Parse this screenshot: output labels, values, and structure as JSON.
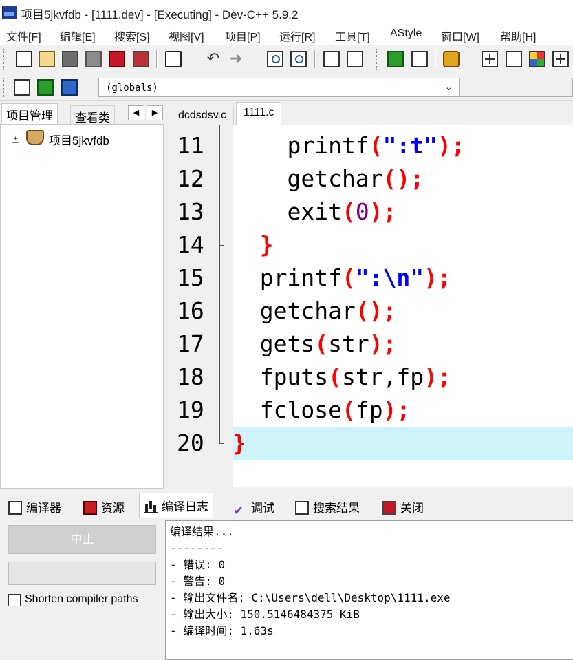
{
  "window": {
    "title": "项目5jkvfdb - [1111.dev] - [Executing] - Dev-C++ 5.9.2",
    "app_icon_label": "DEV"
  },
  "menu": [
    "文件[F]",
    "编辑[E]",
    "搜索[S]",
    "视图[V]",
    "项目[P]",
    "运行[R]",
    "工具[T]",
    "AStyle",
    "窗口[W]",
    "帮助[H]"
  ],
  "toolbar": {
    "icons": [
      "new-file-icon",
      "open-project-icon",
      "save-icon",
      "save-all-icon",
      "close-icon",
      "close-all-icon",
      "print-icon",
      "undo-icon",
      "redo-icon",
      "find-icon",
      "find-replace-icon",
      "indent-icon",
      "unindent-icon",
      "add-to-project-icon",
      "remove-from-project-icon",
      "goto-line-icon",
      "grid-icon",
      "window-icon",
      "color-icon",
      "tiles-icon"
    ],
    "scope_combo_value": "(globals)"
  },
  "left_panel": {
    "tabs": [
      "项目管理",
      "查看类"
    ],
    "active_tab": 0,
    "tree": {
      "expander": "+",
      "project_label": "项目5jkvfdb"
    }
  },
  "editor": {
    "tabs": [
      "dcdsdsv.c",
      "1111.c"
    ],
    "active_tab": 1,
    "highlight_line": 20,
    "lines": [
      {
        "num": "11",
        "tokens": [
          [
            "k",
            "    printf"
          ],
          [
            "p",
            "("
          ],
          [
            "s",
            "\":t\""
          ],
          [
            "p",
            ");"
          ]
        ]
      },
      {
        "num": "12",
        "tokens": [
          [
            "k",
            "    getchar"
          ],
          [
            "p",
            "();"
          ]
        ]
      },
      {
        "num": "13",
        "tokens": [
          [
            "k",
            "    exit"
          ],
          [
            "p",
            "("
          ],
          [
            "n",
            "0"
          ],
          [
            "p",
            ");"
          ]
        ]
      },
      {
        "num": "14",
        "tokens": [
          [
            "p",
            "  }"
          ]
        ]
      },
      {
        "num": "15",
        "tokens": [
          [
            "k",
            "  printf"
          ],
          [
            "p",
            "("
          ],
          [
            "s",
            "\":\\n\""
          ],
          [
            "p",
            ");"
          ]
        ]
      },
      {
        "num": "16",
        "tokens": [
          [
            "k",
            "  getchar"
          ],
          [
            "p",
            "();"
          ]
        ]
      },
      {
        "num": "17",
        "tokens": [
          [
            "k",
            "  gets"
          ],
          [
            "p",
            "("
          ],
          [
            "k",
            "str"
          ],
          [
            "p",
            ");"
          ]
        ]
      },
      {
        "num": "18",
        "tokens": [
          [
            "k",
            "  fputs"
          ],
          [
            "p",
            "("
          ],
          [
            "k",
            "str,fp"
          ],
          [
            "p",
            ");"
          ]
        ]
      },
      {
        "num": "19",
        "tokens": [
          [
            "k",
            "  fclose"
          ],
          [
            "p",
            "("
          ],
          [
            "k",
            "fp"
          ],
          [
            "p",
            ");"
          ]
        ]
      },
      {
        "num": "20",
        "tokens": [
          [
            "p",
            "}"
          ]
        ]
      }
    ],
    "colors": {
      "keyword": "#000000",
      "punct": "#ff0000",
      "string": "#0000ff",
      "number": "#800080",
      "highlight": "#cdf5f9"
    }
  },
  "bottom_panel": {
    "tabs": [
      {
        "label": "编译器",
        "icon": "grid-icon"
      },
      {
        "label": "资源",
        "icon": "resources-icon"
      },
      {
        "label": "编译日志",
        "icon": "chart-icon"
      },
      {
        "label": "调试",
        "icon": "check-icon"
      },
      {
        "label": "搜索结果",
        "icon": "find-icon"
      },
      {
        "label": "关闭",
        "icon": "close-icon"
      }
    ],
    "active_tab": 2,
    "abort_button": "中止",
    "shorten_paths_label": "Shorten compiler paths",
    "shorten_paths_checked": false,
    "log_lines": [
      "编译结果...",
      "--------",
      "- 错误: 0",
      "- 警告: 0",
      "- 输出文件名: C:\\Users\\dell\\Desktop\\1111.exe",
      "- 输出大小: 150.5146484375 KiB",
      "- 编译时间: 1.63s"
    ]
  }
}
